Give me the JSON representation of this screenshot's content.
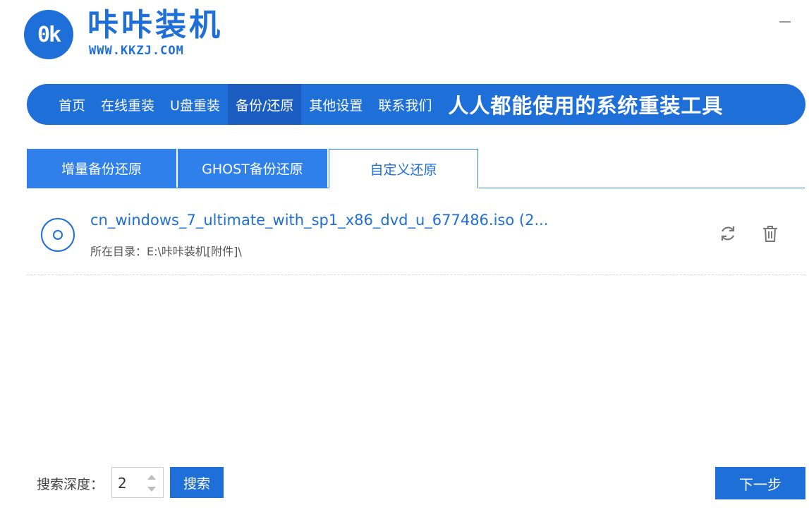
{
  "header": {
    "logo_text": "0k",
    "brand_title": "咔咔装机",
    "brand_url": "WWW.KKZJ.COM"
  },
  "nav": {
    "items": [
      {
        "label": "首页"
      },
      {
        "label": "在线重装"
      },
      {
        "label": "U盘重装"
      },
      {
        "label": "备份/还原",
        "active": true
      },
      {
        "label": "其他设置"
      },
      {
        "label": "联系我们"
      }
    ],
    "slogan": "人人都能使用的系统重装工具"
  },
  "tabs": [
    {
      "label": "增量备份还原"
    },
    {
      "label": "GHOST备份还原"
    },
    {
      "label": "自定义还原",
      "active": true
    }
  ],
  "files": [
    {
      "name": "cn_windows_7_ultimate_with_sp1_x86_dvd_u_677486.iso (2...",
      "directory": "所在目录：E:\\咔咔装机[附件]\\"
    }
  ],
  "footer": {
    "depth_label": "搜索深度：",
    "depth_value": "2",
    "search_label": "搜索",
    "next_label": "下一步"
  },
  "colors": {
    "accent": "#1f6fd9",
    "tab_blue": "#2f80ea",
    "nav_active": "#1a5cc0"
  }
}
